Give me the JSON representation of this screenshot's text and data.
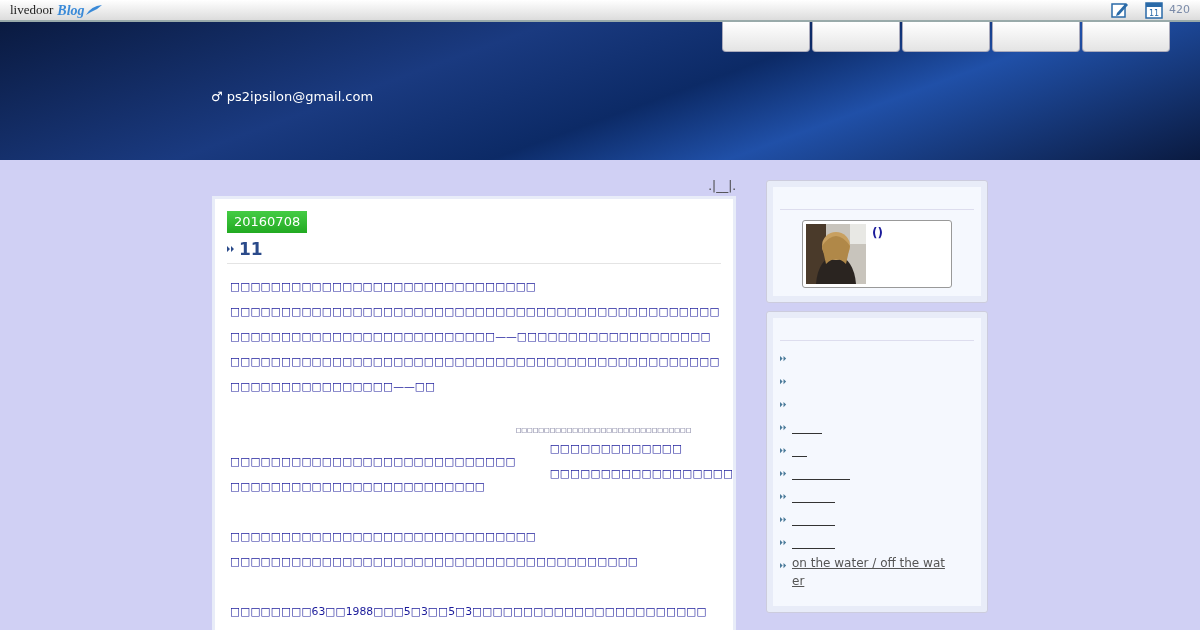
{
  "topbar": {
    "logo": "livedoor",
    "logo_script": "Blog",
    "calendar_day": "11",
    "counter": "420"
  },
  "header": {
    "nav_tabs": [
      {
        "selected": false
      },
      {
        "selected": false
      },
      {
        "selected": false
      },
      {
        "selected": false
      },
      {
        "selected": false
      }
    ],
    "author": "♂ ps2ipsilon@gmail.com"
  },
  "breadcrumb": ".|__|.",
  "post": {
    "date": "20160708",
    "title": "11",
    "paragraphs": [
      {
        "kind": "text",
        "lines": [
          "□□□□□□□□□□□□□□□□□□□□□□□□□□□□□□",
          "□□□□□□□□□□□□□□□□□□□□□□□□□□□□□□□□□□□□□□□□□□□□□□□□",
          "□□□□□□□□□□□□□□□□□□□□□□□□□□——□□□□□□□□□□□□□□□□□□□",
          "□□□□□□□□□□□□□□□□□□□□□□□□□□□□□□□□□□□□□□□□□□□□□□□□",
          "□□□□□□□□□□□□□□□□——□□"
        ]
      },
      {
        "kind": "figure",
        "caption": "□□□□□□□□□□□□□□□□□□□□□□□□□□□□□□□",
        "figure_lines": [
          "□□□□□□□□□□□□□",
          "□□□□□□□□□□□□□□□□□□"
        ],
        "lines": [
          "□□□□□□□□□□□□□□□□□□□□□□□□□□□□",
          "□□□□□□□□□□□□□□□□□□□□□□□□□"
        ]
      },
      {
        "kind": "text",
        "lines": [
          "□□□□□□□□□□□□□□□□□□□□□□□□□□□□□□",
          "□□□□□□□□□□□□□□□□□□□□□□□□□□□□□□□□□□□□□□□□"
        ]
      },
      {
        "kind": "text",
        "lines": [
          "□□□□□□□□63□□1988□□□5□3□□5□3□□□□□□□□□□□□□□□□□□□□□□□"
        ]
      }
    ]
  },
  "sidebar": {
    "profile": {
      "name": "()"
    },
    "links": [
      {
        "kind": "bullet"
      },
      {
        "kind": "bullet"
      },
      {
        "kind": "bullet"
      },
      {
        "kind": "blank_link"
      },
      {
        "kind": "blank_link"
      },
      {
        "kind": "blank_link"
      },
      {
        "kind": "blank_link"
      },
      {
        "kind": "blank_link"
      },
      {
        "kind": "blank_link"
      },
      {
        "kind": "link",
        "text": " on the water / off the water"
      }
    ]
  }
}
